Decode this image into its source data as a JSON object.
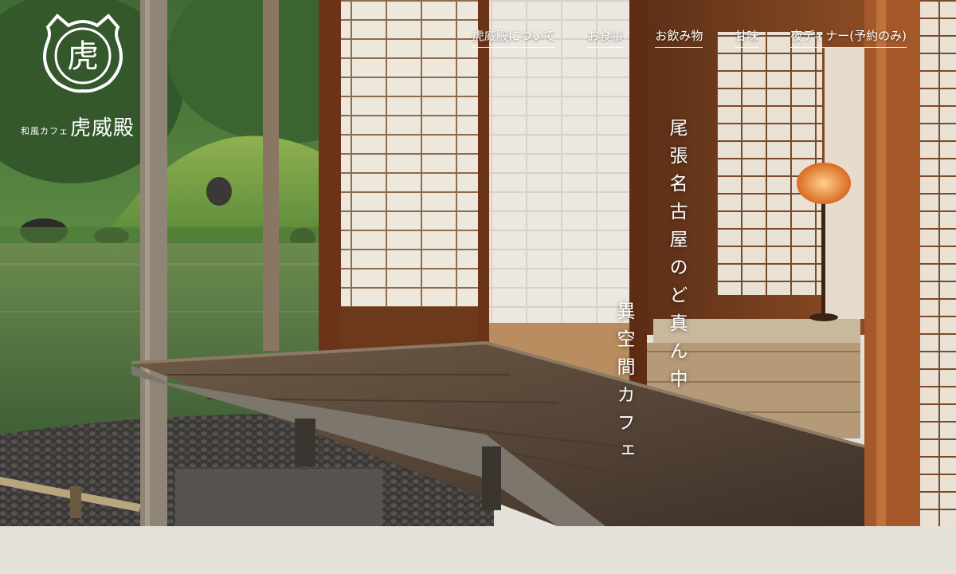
{
  "brand": {
    "emblem_char": "虎",
    "subtitle": "和風カフェ",
    "name": "虎威殿"
  },
  "nav": {
    "items": [
      {
        "label": "虎威殿について"
      },
      {
        "label": "お食事"
      },
      {
        "label": "お飲み物"
      },
      {
        "label": "甘味"
      },
      {
        "label": "夜ディナー(予約のみ)"
      }
    ]
  },
  "hero": {
    "tagline_line1": "尾張名古屋のど真ん中",
    "tagline_line2": "異空間カフェ",
    "image_subject": "japanese-garden-teahouse-photo"
  },
  "colors": {
    "wood": "#7a3f1e",
    "shoji": "#ece6da",
    "pond": "#5b7a4e",
    "page_bg": "#e4e1db"
  }
}
